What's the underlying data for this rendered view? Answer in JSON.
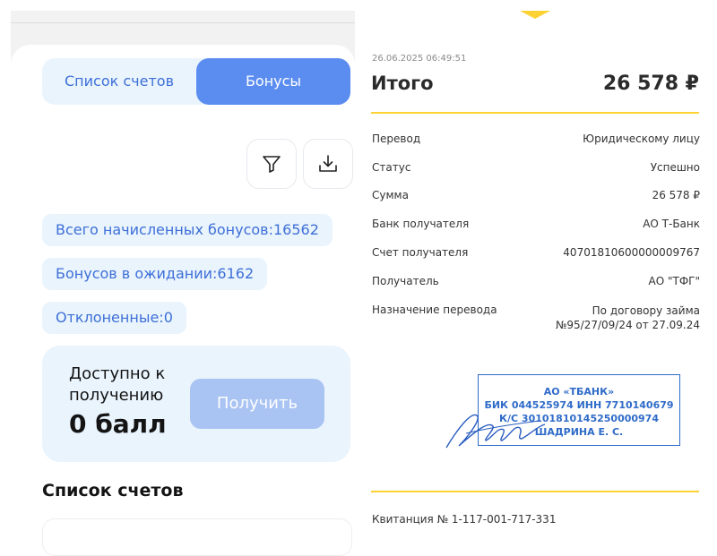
{
  "left_panel": {
    "tabs": [
      "Список счетов",
      "Бонусы"
    ],
    "active_tab": "Бонусы",
    "stats": {
      "total": "Всего начисленных бонусов:16562",
      "pending": "Бонусов в ожидании:6162",
      "rejected": "Отклоненные:0"
    },
    "available": {
      "label": "Доступно к получению",
      "value": "0 балл",
      "button": "Получить"
    },
    "accounts_title": "Список счетов",
    "icons": {
      "filter": "filter-icon",
      "download": "download-icon"
    },
    "colors": {
      "accent": "#5b8df0",
      "chip_bg": "#eaf4fd",
      "chip_text": "#3d6fd8",
      "disabled_button": "#a9c3f3"
    }
  },
  "receipt": {
    "datetime": "26.06.2025 06:49:51",
    "total_label": "Итого",
    "total_value": "26 578 ₽",
    "rows": [
      {
        "key": "Перевод",
        "value": "Юридическому лицу"
      },
      {
        "key": "Статус",
        "value": "Успешно"
      },
      {
        "key": "Сумма",
        "value": "26 578 ₽"
      },
      {
        "key": "Банк получателя",
        "value": "АО Т-Банк"
      },
      {
        "key": "Счет получателя",
        "value": "40701810600000009767"
      },
      {
        "key": "Получатель",
        "value": "АО \"ТФГ\""
      },
      {
        "key": "Назначение перевода",
        "value": "По договору займа №95/27/09/24 от 27.09.24"
      }
    ],
    "stamp": {
      "line1": "АО «ТБАНК»",
      "line2": "БИК 044525974 ИНН 7710140679",
      "line3": "К/С 30101810145250000974",
      "line4": "ШАДРИНА Е. С."
    },
    "footer": "Квитанция  № 1-117-001-717-331",
    "colors": {
      "accent_line": "#ffd234",
      "stamp": "#2f6bc8"
    }
  }
}
